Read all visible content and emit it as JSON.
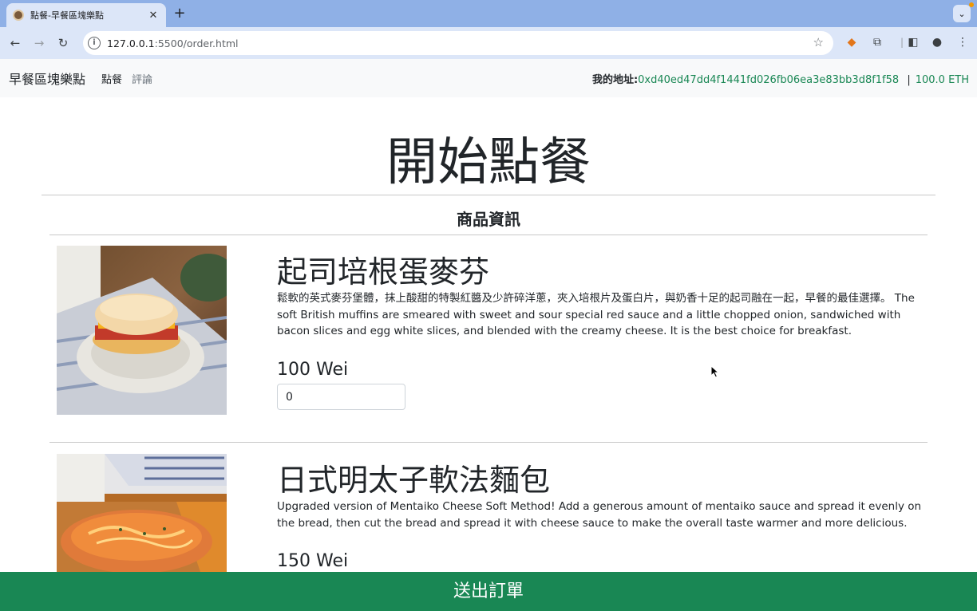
{
  "browser": {
    "tab_title": "點餐-早餐區塊樂點",
    "new_tab": "+",
    "tab_close": "✕",
    "url_host": "127.0.0.1",
    "url_path": ":5500/order.html"
  },
  "navbar": {
    "brand": "早餐區塊樂點",
    "links": [
      "點餐",
      "評論"
    ],
    "address_label": "我的地址:",
    "address": "0xd40ed47dd4f1441fd026fb06ea3e83bb3d8f1f58",
    "separator": "|",
    "balance": "100.0 ETH"
  },
  "page": {
    "title": "開始點餐",
    "section_title": "商品資訊"
  },
  "products": [
    {
      "name": "起司培根蛋麥芬",
      "description": "鬆軟的英式麥芬堡體，抹上酸甜的特製紅醬及少許碎洋蔥，夾入培根片及蛋白片，與奶香十足的起司融在一起，早餐的最佳選擇。 The soft British muffins are smeared with sweet and sour special red sauce and a little chopped onion, sandwiched with bacon slices and egg white slices, and blended with the creamy cheese. It is the best choice for breakfast.",
      "price": "100 Wei",
      "quantity": "0"
    },
    {
      "name": "日式明太子軟法麵包",
      "description": "Upgraded version of Mentaiko Cheese Soft Method! Add a generous amount of mentaiko sauce and spread it evenly on the bread, then cut the bread and spread it with cheese sauce to make the overall taste warmer and more delicious.",
      "price": "150 Wei"
    }
  ],
  "submit_label": "送出訂單",
  "colors": {
    "accent_green": "#198754",
    "tabbar": "#8fb0e6",
    "toolbar": "#dce6f8"
  }
}
